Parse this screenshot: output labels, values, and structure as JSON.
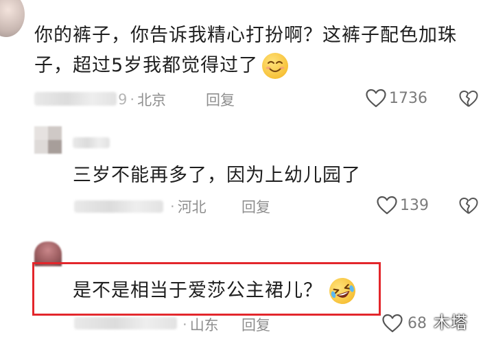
{
  "comments": [
    {
      "text_line1": "你的裤子，你告诉我精心打扮啊？这裤子配色加珠",
      "text_line2": "子，超过5岁我都觉得过了",
      "emoji": "smiling-face-icon",
      "location": "北京",
      "reply_label": "回复",
      "likes": "1736"
    },
    {
      "text": "三岁不能再多了，因为上幼儿园了",
      "location": "河北",
      "reply_label": "回复",
      "likes": "139"
    },
    {
      "text": "是不是相当于爱莎公主裙儿？",
      "emoji": "rolling-laughing-face-icon",
      "location": "山东",
      "reply_label": "回复",
      "likes": "68"
    }
  ],
  "partial_date_glyph": "9",
  "watermark": "木塔",
  "colors": {
    "highlight_border": "#e3262b",
    "meta_gray": "#8e8e8e",
    "text": "#1e1e1e"
  }
}
